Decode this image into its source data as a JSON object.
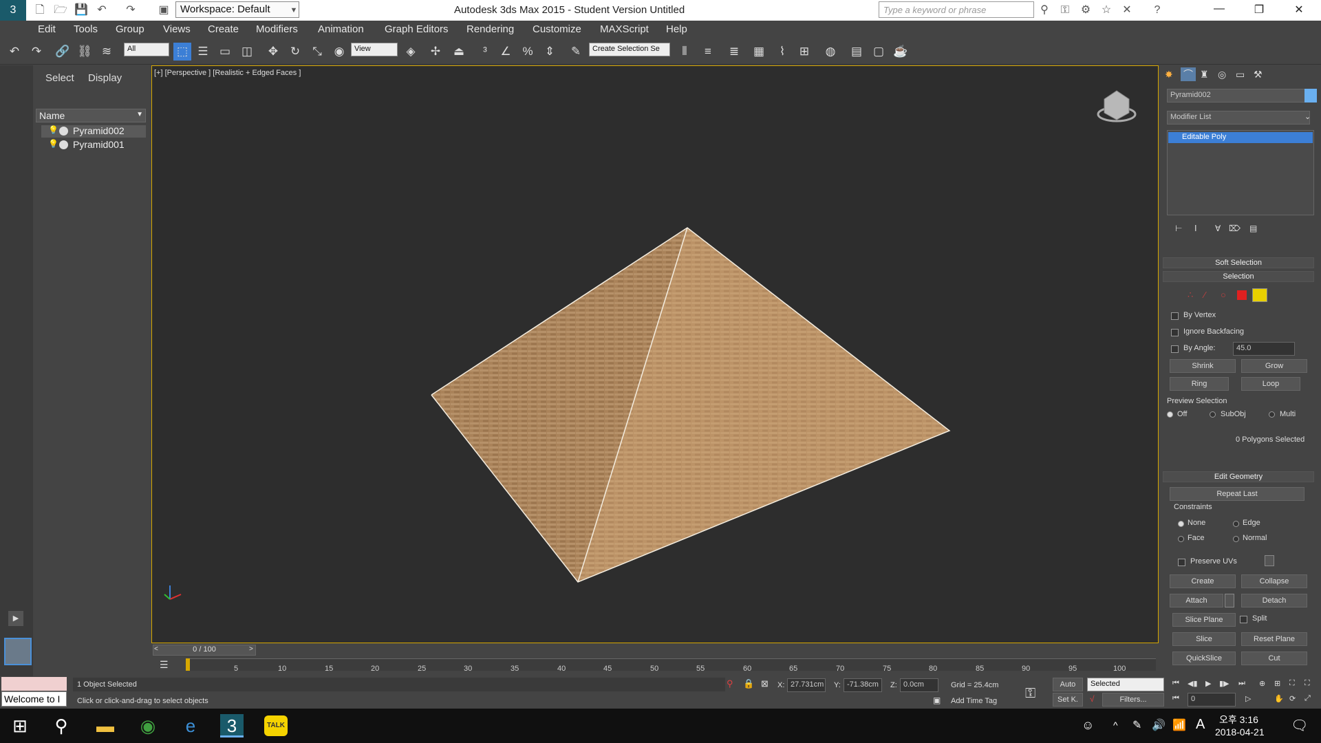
{
  "window": {
    "title": "Autodesk 3ds Max  2015   - Student Version     Untitled",
    "workspace": "Workspace: Default",
    "search_placeholder": "Type a keyword or phrase"
  },
  "menu": [
    "Edit",
    "Tools",
    "Group",
    "Views",
    "Create",
    "Modifiers",
    "Animation",
    "Graph Editors",
    "Rendering",
    "Customize",
    "MAXScript",
    "Help"
  ],
  "toolbar": {
    "filter_value": "All",
    "refcoord_value": "View",
    "named_selection": "Create Selection Se"
  },
  "scene_explorer": {
    "tab_select": "Select",
    "tab_display": "Display",
    "column_name": "Name",
    "objects": [
      "Pyramid002",
      "Pyramid001"
    ]
  },
  "viewport": {
    "label": "[+] [Perspective ] [Realistic + Edged Faces ]"
  },
  "command_panel": {
    "object_name": "Pyramid002",
    "modifier_list": "Modifier List",
    "stack_item": "Editable Poly",
    "soft_selection": "Soft Selection",
    "selection": "Selection",
    "by_vertex": "By Vertex",
    "ignore_backfacing": "Ignore Backfacing",
    "by_angle": "By Angle:",
    "angle_value": "45.0",
    "shrink": "Shrink",
    "grow": "Grow",
    "ring": "Ring",
    "loop": "Loop",
    "preview_selection": "Preview Selection",
    "off": "Off",
    "subobj": "SubObj",
    "multi": "Multi",
    "polys_selected": "0 Polygons Selected",
    "edit_geometry": "Edit Geometry",
    "repeat_last": "Repeat Last",
    "constraints": "Constraints",
    "none": "None",
    "edge": "Edge",
    "face": "Face",
    "normal": "Normal",
    "preserve_uvs": "Preserve UVs",
    "create": "Create",
    "collapse": "Collapse",
    "attach": "Attach",
    "detach": "Detach",
    "slice_plane": "Slice Plane",
    "split": "Split",
    "slice": "Slice",
    "reset_plane": "Reset Plane",
    "quickslice": "QuickSlice",
    "cut": "Cut"
  },
  "timeline": {
    "frame_counter": "0 / 100",
    "ticks": [
      "5",
      "10",
      "15",
      "20",
      "25",
      "30",
      "35",
      "40",
      "45",
      "50",
      "55",
      "60",
      "65",
      "70",
      "75",
      "80",
      "85",
      "90",
      "95",
      "100"
    ]
  },
  "status": {
    "welcome": "Welcome to I",
    "objects_selected": "1 Object Selected",
    "prompt": "Click or click-and-drag to select objects",
    "x_label": "X:",
    "x_value": "27.731cm",
    "y_label": "Y:",
    "y_value": "-71.38cm",
    "z_label": "Z:",
    "z_value": "0.0cm",
    "grid": "Grid = 25.4cm",
    "add_time_tag": "Add Time Tag",
    "auto": "Auto",
    "set_k": "Set K.",
    "selected_dd": "Selected",
    "filters": "Filters...",
    "frame_value": "0"
  },
  "taskbar": {
    "time": "오후 3:16",
    "date": "2018-04-21",
    "ime": "A",
    "talk": "TALK"
  },
  "colors": {
    "viewport_border": "#d7a800",
    "selected_stack": "#3c7fd6",
    "face_selection_icon": "#e8d000"
  }
}
